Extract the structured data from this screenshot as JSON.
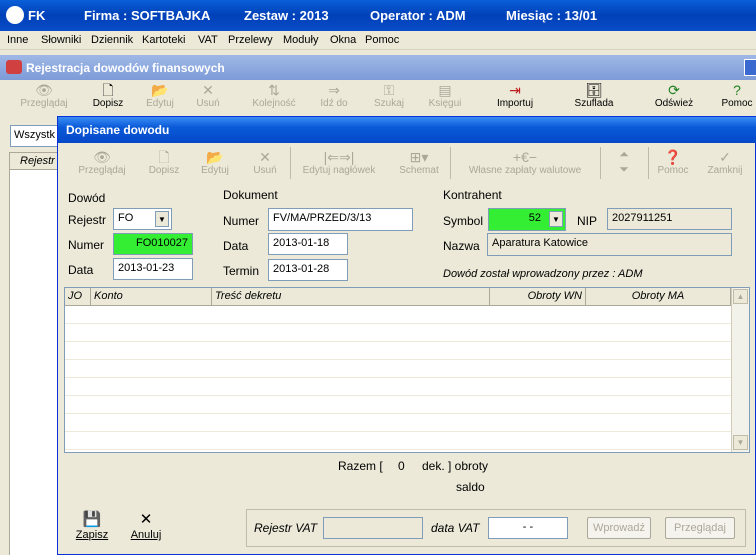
{
  "app": {
    "name": "FK",
    "firma": "Firma : SOFTBAJKA",
    "zestaw": "Zestaw : 2013",
    "operator": "Operator : ADM",
    "miesiac": "Miesiąc : 13/01"
  },
  "menu": [
    "Inne",
    "Słowniki",
    "Dziennik",
    "Kartoteki",
    "VAT",
    "Przelewy",
    "Moduły",
    "Okna",
    "Pomoc"
  ],
  "child_window": {
    "title": "Rejestracja dowodów finansowych"
  },
  "main_toolbar": [
    {
      "label": "Przeglądaj",
      "icon": "eye-icon",
      "glyph": "👁"
    },
    {
      "label": "Dopisz",
      "icon": "document-icon",
      "glyph": "🗋"
    },
    {
      "label": "Edytuj",
      "icon": "folder-open-icon",
      "glyph": "📂"
    },
    {
      "label": "Usuń",
      "icon": "x-icon",
      "glyph": "✕"
    },
    {
      "label": "Kolejność",
      "icon": "sort-icon",
      "glyph": "⇅"
    },
    {
      "label": "Idź do",
      "icon": "goto-icon",
      "glyph": "⇒"
    },
    {
      "label": "Szukaj",
      "icon": "key-icon",
      "glyph": "⚿"
    },
    {
      "label": "Księgui",
      "icon": "book-icon",
      "glyph": "▤"
    },
    {
      "label": "Importuj",
      "icon": "import-icon",
      "glyph": "⇥"
    },
    {
      "label": "Szuflada",
      "icon": "drawer-icon",
      "glyph": "🗄"
    },
    {
      "label": "Odśwież",
      "icon": "refresh-icon",
      "glyph": "⟳"
    },
    {
      "label": "Pomoc",
      "icon": "help-icon",
      "glyph": "?"
    }
  ],
  "background": {
    "filter_value": "Wszystk",
    "column_header": "Rejestr"
  },
  "dialog": {
    "title": "Dopisane dowodu",
    "toolbar": [
      {
        "label": "Przeglądaj",
        "icon": "eye-icon",
        "glyph": "👁"
      },
      {
        "label": "Dopisz",
        "icon": "document-icon",
        "glyph": "🗋"
      },
      {
        "label": "Edytuj",
        "icon": "folder-open-icon",
        "glyph": "📂"
      },
      {
        "label": "Usuń",
        "icon": "x-icon",
        "glyph": "✕"
      },
      {
        "label": "Edytuj nagłówek",
        "icon": "edit-header-icon",
        "glyph": "|⇐⇒|"
      },
      {
        "label": "Schemat",
        "icon": "schema-icon",
        "glyph": "⊞▾"
      },
      {
        "label": "Własne zapłaty walutowe",
        "icon": "currency-icon",
        "glyph": "+€−"
      },
      {
        "label": "Pomoc",
        "icon": "help-icon",
        "glyph": "❓"
      },
      {
        "label": "Zamknij",
        "icon": "check-icon",
        "glyph": "✓"
      }
    ],
    "nav_arrows": [
      "⏶",
      "⏷"
    ],
    "dowod": {
      "section": "Dowód",
      "rejestr_label": "Rejestr",
      "rejestr_value": "FO",
      "numer_label": "Numer",
      "numer_value": "FO010027",
      "data_label": "Data",
      "data_value": "2013-01-23"
    },
    "dokument": {
      "section": "Dokument",
      "numer_label": "Numer",
      "numer_value": "FV/MA/PRZED/3/13",
      "data_label": "Data",
      "data_value": "2013-01-18",
      "termin_label": "Termin",
      "termin_value": "2013-01-28"
    },
    "kontrahent": {
      "section": "Kontrahent",
      "symbol_label": "Symbol",
      "symbol_value": "52",
      "nip_label": "NIP",
      "nip_value": "2027911251",
      "nazwa_label": "Nazwa",
      "nazwa_value": "Aparatura Katowice"
    },
    "entered_by": "Dowód został wprowadzony przez :  ADM",
    "grid_columns": [
      "JO",
      "Konto",
      "Treść dekretu",
      "Obroty WN",
      "Obroty MA"
    ],
    "razem": {
      "prefix": "Razem [",
      "count": "0",
      "suffix": "dek. ] obroty",
      "saldo": "saldo"
    },
    "buttons": {
      "zapisz": "Zapisz",
      "anuluj": "Anuluj"
    },
    "vat": {
      "rejestr_label": "Rejestr VAT",
      "rejestr_value": "",
      "data_label": "data VAT",
      "data_value": "- -",
      "wprowadz": "Wprowadź",
      "przegladaj": "Przeglądaj"
    }
  }
}
